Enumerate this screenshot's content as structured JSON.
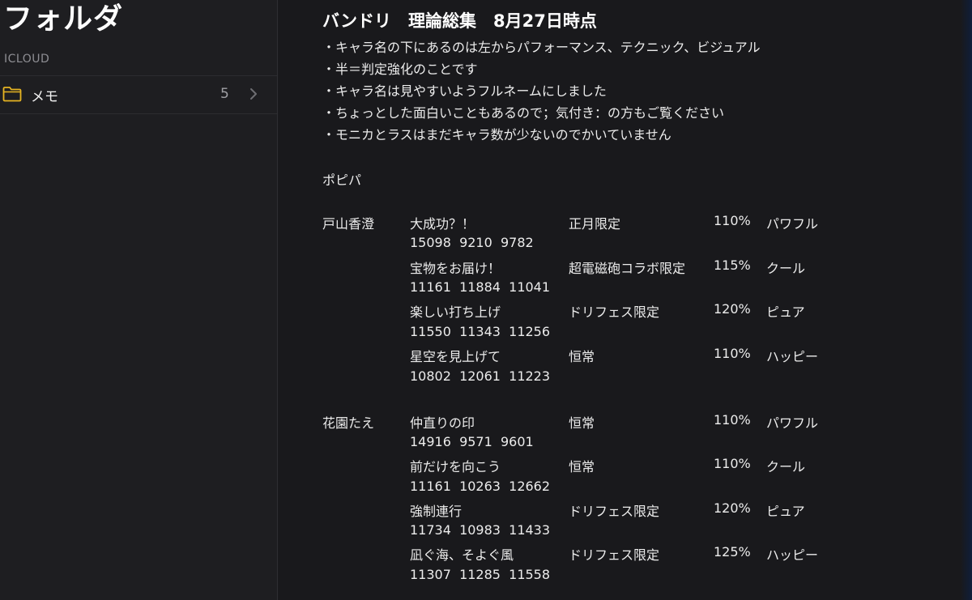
{
  "sidebar": {
    "title": "フォルダ",
    "section_header": "ICLOUD",
    "folders": [
      {
        "label": "メモ",
        "count": "5",
        "icon": "folder-icon"
      }
    ]
  },
  "note": {
    "title": "バンドリ　理論総集　8月27日時点",
    "bullets": [
      "・キャラ名の下にあるのは左からパフォーマンス、テクニック、ビジュアル",
      "・半＝判定強化のことです",
      "・キャラ名は見やすいようフルネームにしました",
      "・ちょっとした面白いこともあるので；気付き：の方もご覧ください",
      "・モニカとラスはまだキャラ数が少ないのでかいていません"
    ],
    "group": "ポピパ",
    "characters": [
      {
        "name": "戸山香澄",
        "cards": [
          {
            "title": "大成功？！",
            "stats": "15098  9210  9782",
            "type": "正月限定",
            "percent": "110%",
            "attribute": "パワフル"
          },
          {
            "title": "宝物をお届け！",
            "stats": "11161  11884  11041",
            "type": "超電磁砲コラボ限定",
            "percent": "115%",
            "attribute": "クール"
          },
          {
            "title": "楽しい打ち上げ",
            "stats": "11550  11343  11256",
            "type": "ドリフェス限定",
            "percent": "120%",
            "attribute": "ピュア"
          },
          {
            "title": "星空を見上げて",
            "stats": "10802  12061  11223",
            "type": "恒常",
            "percent": "110%",
            "attribute": "ハッピー"
          }
        ]
      },
      {
        "name": "花園たえ",
        "cards": [
          {
            "title": "仲直りの印",
            "stats": "14916  9571  9601",
            "type": "恒常",
            "percent": "110%",
            "attribute": "パワフル"
          },
          {
            "title": "前だけを向こう",
            "stats": "11161  10263  12662",
            "type": "恒常",
            "percent": "110%",
            "attribute": "クール"
          },
          {
            "title": "強制連行",
            "stats": "11734  10983  11433",
            "type": "ドリフェス限定",
            "percent": "120%",
            "attribute": "ピュア"
          },
          {
            "title": "凪ぐ海、そよぐ風",
            "stats": "11307  11285  11558",
            "type": "ドリフェス限定",
            "percent": "125%",
            "attribute": "ハッピー"
          }
        ]
      }
    ]
  },
  "colors": {
    "accent": "#e6b422",
    "background": "#1a1a1d",
    "text": "#ececec",
    "secondary_text": "#8e8e93"
  }
}
